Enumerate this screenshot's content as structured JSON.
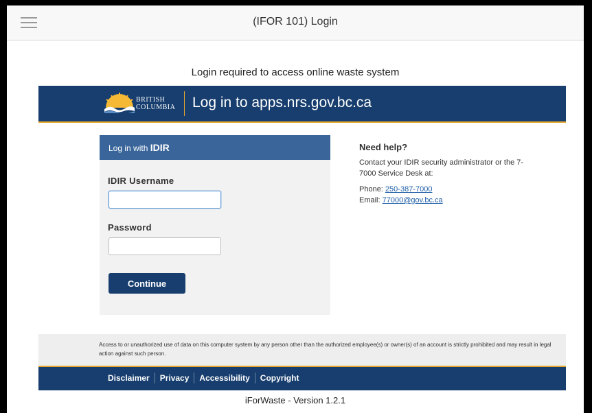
{
  "app": {
    "title": "(IFOR 101) Login"
  },
  "login_required": "Login required to access online waste system",
  "bc_header": {
    "logo_line1": "BRITISH",
    "logo_line2": "COLUMBIA",
    "title": "Log in to apps.nrs.gov.bc.ca"
  },
  "login_panel": {
    "heading_prefix": "Log in with",
    "heading_strong": "IDIR",
    "username_label": "IDIR Username",
    "username_value": "",
    "password_label": "Password",
    "password_value": "",
    "continue_label": "Continue"
  },
  "help": {
    "title": "Need help?",
    "text": "Contact your IDIR security administrator or the 7-7000 Service Desk at:",
    "phone_label": "Phone:",
    "phone_value": "250-387-7000",
    "email_label": "Email:",
    "email_value": "77000@gov.bc.ca"
  },
  "notice": "Access to or unauthorized use of data on this computer system by any person other than the authorized employee(s) or owner(s) of an account is strictly prohibited and may result in legal action against such person.",
  "footer": {
    "links": [
      "Disclaimer",
      "Privacy",
      "Accessibility",
      "Copyright"
    ]
  },
  "version": "iForWaste - Version 1.2.1",
  "colors": {
    "bc_blue": "#173e6e",
    "bc_gold": "#e3a82b",
    "panel_header": "#39659a",
    "link": "#1f5fa8"
  },
  "icons": {
    "menu": "hamburger-menu-icon",
    "logo": "bc-sun-logo-icon"
  }
}
